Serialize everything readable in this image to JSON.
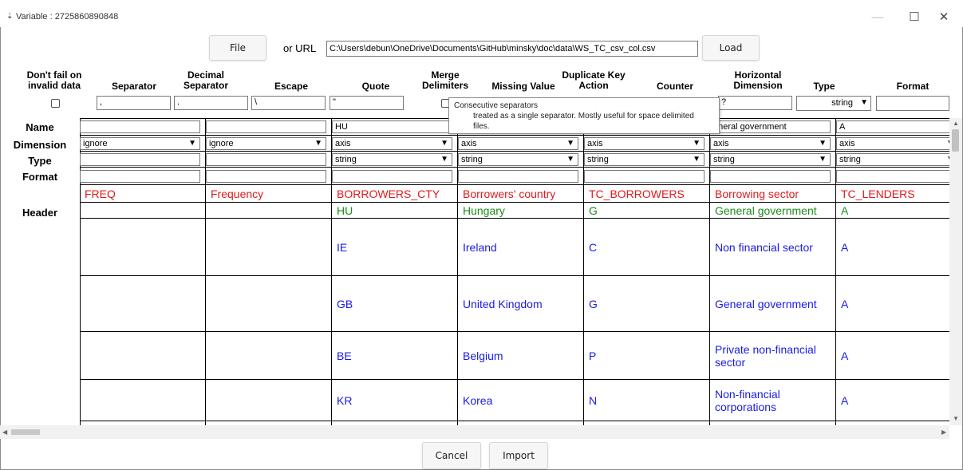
{
  "window": {
    "title": "Variable : 2725860890848",
    "minimize": "—",
    "maximize": "☐",
    "close": "✕"
  },
  "toolbar": {
    "file_label": "File",
    "or_url_label": "or URL",
    "url_value": "C:\\Users\\debun\\OneDrive\\Documents\\GitHub\\minsky\\doc\\data\\WS_TC_csv_col.csv",
    "load_label": "Load"
  },
  "options": {
    "dont_fail_label": "Don't fail on invalid data",
    "separator_label": "Separator",
    "separator_value": ",",
    "decimal_separator_label": "Decimal Separator",
    "decimal_separator_value": ".",
    "escape_label": "Escape",
    "escape_value": "\\",
    "quote_label": "Quote",
    "quote_value": "\"",
    "merge_delimiters_label": "Merge Delimiters",
    "missing_value_label": "Missing Value",
    "duplicate_key_label": "Duplicate Key Action",
    "counter_label": "Counter",
    "horizontal_dimension_label": "Horizontal Dimension",
    "horizontal_dimension_value": "?",
    "type_label": "Type",
    "type_value": "string",
    "format_label": "Format"
  },
  "tooltip": {
    "line1": "Consecutive separators",
    "line2": "treated as a single separator. Mostly useful for space delimited",
    "line3": "files."
  },
  "row_labels": {
    "name": "Name",
    "dimension": "Dimension",
    "type": "Type",
    "format": "Format",
    "header": "Header"
  },
  "columns": [
    {
      "name": "",
      "dimension": "ignore",
      "type": "",
      "header_key": "FREQ",
      "header_value": "",
      "rows": [
        "",
        "",
        "",
        ""
      ]
    },
    {
      "name": "",
      "dimension": "ignore",
      "type": "",
      "header_key": "Frequency",
      "header_value": "",
      "rows": [
        "",
        "",
        "",
        ""
      ]
    },
    {
      "name": "HU",
      "dimension": "axis",
      "type": "string",
      "header_key": "BORROWERS_CTY",
      "header_value": "HU",
      "rows": [
        "IE",
        "GB",
        "BE",
        "KR"
      ]
    },
    {
      "name": "",
      "dimension": "axis",
      "type": "string",
      "header_key": "Borrowers' country",
      "header_value": "Hungary",
      "rows": [
        "Ireland",
        "United Kingdom",
        "Belgium",
        "Korea"
      ]
    },
    {
      "name": "",
      "dimension": "axis",
      "type": "string",
      "header_key": "TC_BORROWERS",
      "header_value": "G",
      "rows": [
        "C",
        "G",
        "P",
        "N"
      ]
    },
    {
      "name": "eneral government",
      "dimension": "axis",
      "type": "string",
      "header_key": "Borrowing sector",
      "header_value": "General government",
      "rows": [
        "Non financial sector",
        "General government",
        "Private non-financial sector",
        "Non-financial corporations"
      ]
    },
    {
      "name": "A",
      "dimension": "axis",
      "type": "string",
      "header_key": "TC_LENDERS",
      "header_value": "A",
      "rows": [
        "A",
        "A",
        "A",
        "A"
      ]
    }
  ],
  "footer": {
    "cancel_label": "Cancel",
    "import_label": "Import"
  },
  "colors": {
    "header_key": "#e01b1b",
    "header_value": "#1b8a1b",
    "data": "#1a1ae6"
  }
}
